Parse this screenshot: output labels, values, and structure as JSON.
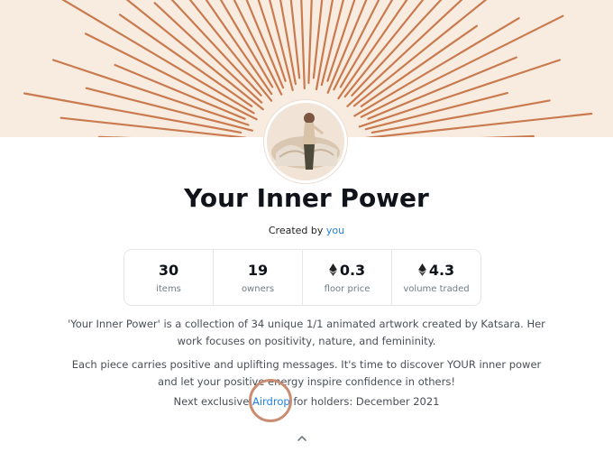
{
  "collection": {
    "title": "Your Inner Power",
    "created_by_prefix": "Created by",
    "creator": "you"
  },
  "stats": [
    {
      "value": "30",
      "label": "items",
      "currency_icon": ""
    },
    {
      "value": "19",
      "label": "owners",
      "currency_icon": ""
    },
    {
      "value": "0.3",
      "label": "floor price",
      "currency_icon": "ethereum-icon"
    },
    {
      "value": "4.3",
      "label": "volume traded",
      "currency_icon": "ethereum-icon"
    }
  ],
  "description": {
    "line1": "'Your Inner Power' is a collection of 34 unique 1/1 animated artwork created by Katsara. Her work focuses on positivity, nature, and femininity.",
    "line2": "Each piece carries positive and uplifting messages. It's time to discover YOUR inner power and let your positive energy inspire confidence in others!",
    "next_prefix": "Next exclusive",
    "airdrop_link": "Airdrop",
    "next_suffix": "for holders: December 2021"
  },
  "icons": {
    "collapse": "chevron-up-icon",
    "avatar": "avatar-image"
  },
  "colors": {
    "banner_bg": "#f8ece0",
    "ray": "#c97a4e",
    "link": "#2081e2",
    "highlight_ring": "#c98e72"
  }
}
